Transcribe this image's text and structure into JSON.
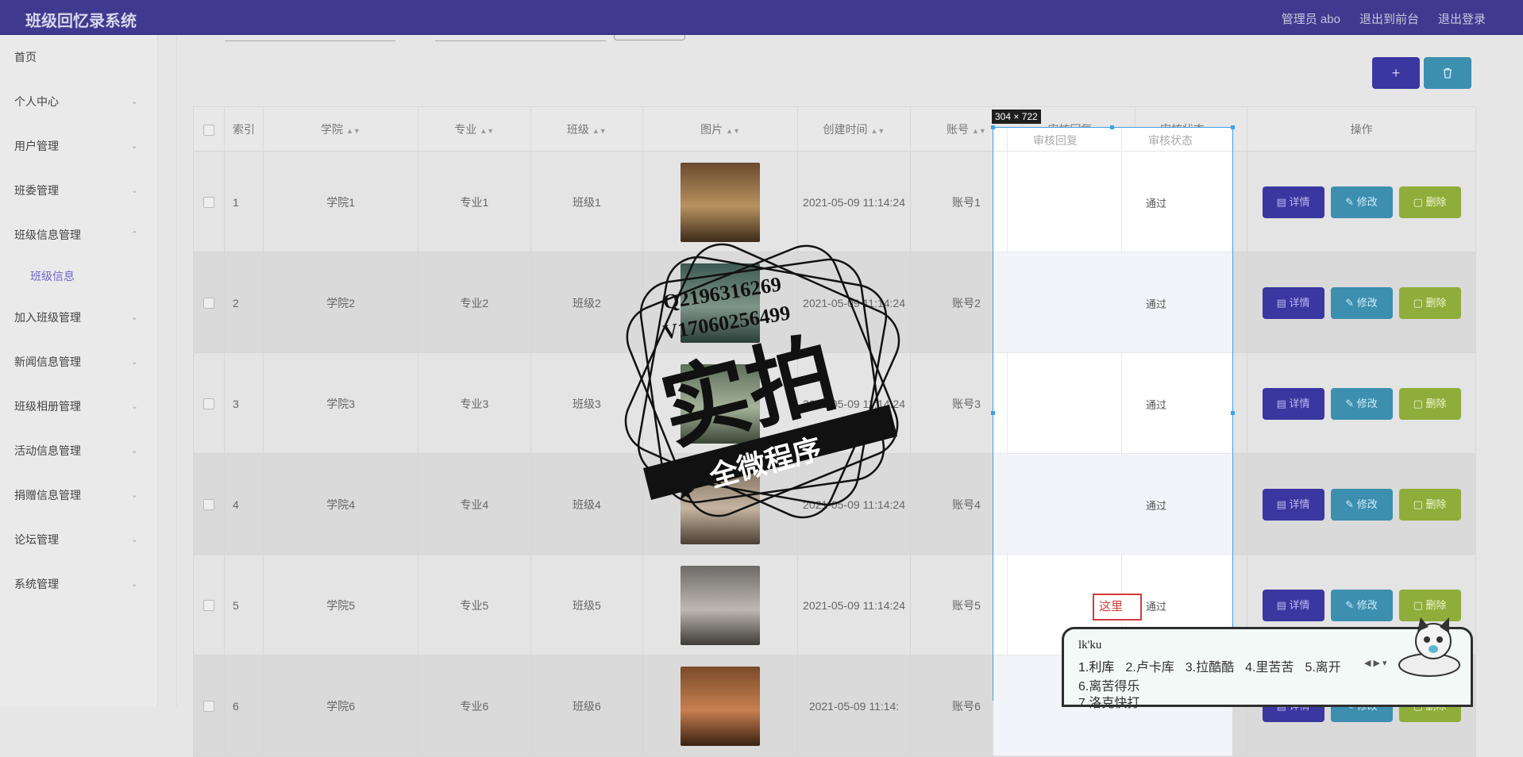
{
  "header": {
    "title": "班级回忆录系统",
    "admin": "管理员 abo",
    "to_front": "退出到前台",
    "logout": "退出登录"
  },
  "sidebar": {
    "items": [
      {
        "label": "首页",
        "chevron": false
      },
      {
        "label": "个人中心",
        "chevron": true
      },
      {
        "label": "用户管理",
        "chevron": true
      },
      {
        "label": "班委管理",
        "chevron": true
      },
      {
        "label": "班级信息管理",
        "chevron": true,
        "expanded": true
      },
      {
        "label": "加入班级管理",
        "chevron": true
      },
      {
        "label": "新闻信息管理",
        "chevron": true
      },
      {
        "label": "班级相册管理",
        "chevron": true
      },
      {
        "label": "活动信息管理",
        "chevron": true
      },
      {
        "label": "捐赠信息管理",
        "chevron": true
      },
      {
        "label": "论坛管理",
        "chevron": true
      },
      {
        "label": "系统管理",
        "chevron": true
      }
    ],
    "sub_item": "班级信息"
  },
  "toolbar": {
    "add_icon": "plus-icon",
    "delete_icon": "trash-icon"
  },
  "table": {
    "headers": [
      "索引",
      "学院",
      "专业",
      "班级",
      "图片",
      "创建时间",
      "账号",
      "审核回复",
      "审核状态",
      "操作"
    ],
    "rows": [
      {
        "index": "1",
        "college": "学院1",
        "major": "专业1",
        "class": "班级1",
        "created": "2021-05-09 11:14:24",
        "account": "账号1",
        "reply": "",
        "status": "通过"
      },
      {
        "index": "2",
        "college": "学院2",
        "major": "专业2",
        "class": "班级2",
        "created": "2021-05-09 11:14:24",
        "account": "账号2",
        "reply": "",
        "status": "通过"
      },
      {
        "index": "3",
        "college": "学院3",
        "major": "专业3",
        "class": "班级3",
        "created": "2021-05-09 11:14:24",
        "account": "账号3",
        "reply": "",
        "status": "通过"
      },
      {
        "index": "4",
        "college": "学院4",
        "major": "专业4",
        "class": "班级4",
        "created": "2021-05-09 11:14:24",
        "account": "账号4",
        "reply": "",
        "status": "通过"
      },
      {
        "index": "5",
        "college": "学院5",
        "major": "专业5",
        "class": "班级5",
        "created": "2021-05-09 11:14:24",
        "account": "账号5",
        "reply": "",
        "status": "通过"
      },
      {
        "index": "6",
        "college": "学院6",
        "major": "专业6",
        "class": "班级6",
        "created": "2021-05-09 11:14:",
        "account": "账号6",
        "reply": "",
        "status": ""
      }
    ],
    "actions": {
      "detail": "详情",
      "edit": "修改",
      "delete": "删除"
    }
  },
  "selection": {
    "size_label": "304 × 722",
    "annotation": "这里"
  },
  "ime": {
    "pinyin": "lk'ku",
    "candidates": [
      "1.利库",
      "2.卢卡库",
      "3.拉酷酷",
      "4.里苦苦",
      "5.离开"
    ],
    "extra": [
      "6.离苦得乐",
      "7.洛克快打"
    ]
  },
  "watermark": {
    "line1": "Q2196316269",
    "line2": "V17060256499",
    "big": "实拍",
    "ribbon": "全微程序"
  },
  "colors": {
    "topbar": "#3f3a8f",
    "detail_btn": "#3a37a0",
    "edit_btn": "#3d8fb0",
    "delete_btn": "#8fad3a",
    "selection": "#3aa2e8",
    "annotation": "#d23b3b"
  }
}
